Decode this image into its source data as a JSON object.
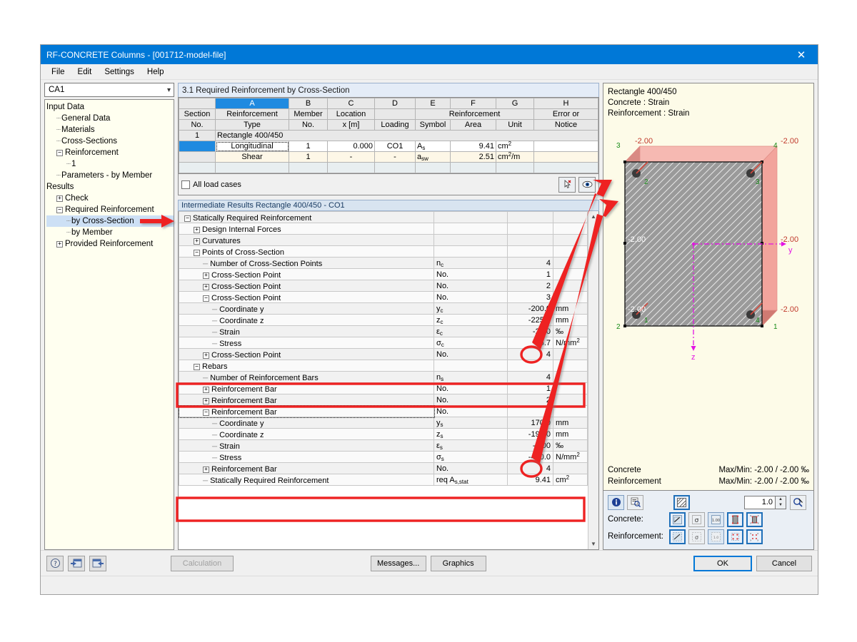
{
  "window": {
    "title": "RF-CONCRETE Columns - [001712-model-file]",
    "close_icon": "close-icon"
  },
  "menu": {
    "items": [
      "File",
      "Edit",
      "Settings",
      "Help"
    ]
  },
  "sidebar": {
    "combo_value": "CA1",
    "nodes": [
      {
        "label": "Input Data",
        "depth": 0,
        "toggle": "none",
        "selected": false
      },
      {
        "label": "General Data",
        "depth": 1,
        "toggle": "leaf",
        "selected": false
      },
      {
        "label": "Materials",
        "depth": 1,
        "toggle": "leaf",
        "selected": false
      },
      {
        "label": "Cross-Sections",
        "depth": 1,
        "toggle": "leaf",
        "selected": false
      },
      {
        "label": "Reinforcement",
        "depth": 1,
        "toggle": "minus",
        "selected": false
      },
      {
        "label": "1",
        "depth": 2,
        "toggle": "leaf",
        "selected": false
      },
      {
        "label": "Parameters - by Member",
        "depth": 1,
        "toggle": "leaf",
        "selected": false
      },
      {
        "label": "Results",
        "depth": 0,
        "toggle": "none",
        "selected": false
      },
      {
        "label": "Check",
        "depth": 1,
        "toggle": "plus",
        "selected": false
      },
      {
        "label": "Required Reinforcement",
        "depth": 1,
        "toggle": "minus",
        "selected": false
      },
      {
        "label": "by Cross-Section",
        "depth": 2,
        "toggle": "leaf",
        "selected": true
      },
      {
        "label": "by Member",
        "depth": 2,
        "toggle": "leaf",
        "selected": false
      },
      {
        "label": "Provided Reinforcement",
        "depth": 1,
        "toggle": "plus",
        "selected": false
      }
    ]
  },
  "main": {
    "panel_title": "3.1 Required Reinforcement by Cross-Section",
    "column_letters": [
      "A",
      "B",
      "C",
      "D",
      "E",
      "F",
      "G",
      "H"
    ],
    "group_headers": {
      "reinforcement": "Reinforcement"
    },
    "headers": [
      {
        "top": "Section",
        "bottom": "No."
      },
      {
        "top": "Reinforcement",
        "bottom": "Type"
      },
      {
        "top": "Member",
        "bottom": "No."
      },
      {
        "top": "Location",
        "bottom": "x [m]"
      },
      {
        "top": "",
        "bottom": "Loading"
      },
      {
        "top": "",
        "bottom": "Symbol"
      },
      {
        "top": "",
        "bottom": "Area"
      },
      {
        "top": "",
        "bottom": "Unit"
      },
      {
        "top": "Error or",
        "bottom": "Notice"
      }
    ],
    "section_row": {
      "no": "1",
      "label": "Rectangle 400/450"
    },
    "rows": [
      {
        "no": "",
        "type": "Longitudinal",
        "member": "1",
        "location": "0.000",
        "loading": "CO1",
        "symbol": "As",
        "symbol_base": "A",
        "symbol_sub": "s",
        "area": "9.41",
        "unit_base": "cm",
        "unit_sup": "2",
        "unit_suffix": "",
        "error": ""
      },
      {
        "no": "",
        "type": "Shear",
        "member": "1",
        "location": "-",
        "loading": "-",
        "symbol": "asw",
        "symbol_base": "a",
        "symbol_sub": "sw",
        "area": "2.51",
        "unit_base": "cm",
        "unit_sup": "2",
        "unit_suffix": "/m",
        "error": ""
      }
    ],
    "all_load_cases_label": "All load cases",
    "all_load_cases_checked": false,
    "pick_icon": "pick-cursor-icon",
    "view_icon": "eye-icon"
  },
  "intermediate": {
    "header": "Intermediate Results Rectangle 400/450 - CO1",
    "rows": [
      {
        "label": "Statically Required Reinforcement",
        "depth": 0,
        "toggle": "minus",
        "symbol": "",
        "value": "",
        "unit": "",
        "highlight": false
      },
      {
        "label": "Design Internal Forces",
        "depth": 1,
        "toggle": "plus",
        "symbol": "",
        "value": "",
        "unit": "",
        "highlight": false
      },
      {
        "label": "Curvatures",
        "depth": 1,
        "toggle": "plus",
        "symbol": "",
        "value": "",
        "unit": "",
        "highlight": false
      },
      {
        "label": "Points of Cross-Section",
        "depth": 1,
        "toggle": "minus",
        "symbol": "",
        "value": "",
        "unit": "",
        "highlight": false
      },
      {
        "label": "Number of Cross-Section Points",
        "depth": 2,
        "toggle": "leaf",
        "symbol": "nc",
        "symbol_base": "n",
        "symbol_sub": "c",
        "value": "4",
        "unit": "",
        "highlight": false
      },
      {
        "label": "Cross-Section Point",
        "depth": 2,
        "toggle": "plus",
        "symbol": "No.",
        "value": "1",
        "unit": "",
        "highlight": false
      },
      {
        "label": "Cross-Section Point",
        "depth": 2,
        "toggle": "plus",
        "symbol": "No.",
        "value": "2",
        "unit": "",
        "highlight": false
      },
      {
        "label": "Cross-Section Point",
        "depth": 2,
        "toggle": "minus",
        "symbol": "No.",
        "value": "3",
        "unit": "",
        "highlight": false,
        "circled": true
      },
      {
        "label": "Coordinate y",
        "depth": 3,
        "toggle": "leaf",
        "symbol": "yc",
        "symbol_base": "y",
        "symbol_sub": "c",
        "value": "-200.0",
        "unit": "mm",
        "highlight": false
      },
      {
        "label": "Coordinate z",
        "depth": 3,
        "toggle": "leaf",
        "symbol": "zc",
        "symbol_base": "z",
        "symbol_sub": "c",
        "value": "-225.0",
        "unit": "mm",
        "highlight": false
      },
      {
        "label": "Strain",
        "depth": 3,
        "toggle": "leaf",
        "symbol": "εc",
        "symbol_base": "ε",
        "symbol_sub": "c",
        "value": "-2.00",
        "unit": "‰",
        "highlight": true
      },
      {
        "label": "Stress",
        "depth": 3,
        "toggle": "leaf",
        "symbol": "σc",
        "symbol_base": "σ",
        "symbol_sub": "c",
        "value": "-16.7",
        "unit": "N/mm2",
        "unit_base": "N/mm",
        "unit_sup": "2",
        "highlight": true
      },
      {
        "label": "Cross-Section Point",
        "depth": 2,
        "toggle": "plus",
        "symbol": "No.",
        "value": "4",
        "unit": "",
        "highlight": false
      },
      {
        "label": "Rebars",
        "depth": 1,
        "toggle": "minus",
        "symbol": "",
        "value": "",
        "unit": "",
        "highlight": false
      },
      {
        "label": "Number of Reinforcement Bars",
        "depth": 2,
        "toggle": "leaf",
        "symbol": "ns",
        "symbol_base": "n",
        "symbol_sub": "s",
        "value": "4",
        "unit": "",
        "highlight": false
      },
      {
        "label": "Reinforcement Bar",
        "depth": 2,
        "toggle": "plus",
        "symbol": "No.",
        "value": "1",
        "unit": "",
        "highlight": false
      },
      {
        "label": "Reinforcement Bar",
        "depth": 2,
        "toggle": "plus",
        "symbol": "No.",
        "value": "2",
        "unit": "",
        "highlight": false
      },
      {
        "label": "Reinforcement Bar",
        "depth": 2,
        "toggle": "minus",
        "symbol": "No.",
        "value": "3",
        "unit": "",
        "highlight": false,
        "circled": true,
        "focused": true
      },
      {
        "label": "Coordinate y",
        "depth": 3,
        "toggle": "leaf",
        "symbol": "ys",
        "symbol_base": "y",
        "symbol_sub": "s",
        "value": "170.0",
        "unit": "mm",
        "highlight": false
      },
      {
        "label": "Coordinate z",
        "depth": 3,
        "toggle": "leaf",
        "symbol": "zs",
        "symbol_base": "z",
        "symbol_sub": "s",
        "value": "-195.0",
        "unit": "mm",
        "highlight": false
      },
      {
        "label": "Strain",
        "depth": 3,
        "toggle": "leaf",
        "symbol": "εs",
        "symbol_base": "ε",
        "symbol_sub": "s",
        "value": "-2.00",
        "unit": "‰",
        "highlight": true
      },
      {
        "label": "Stress",
        "depth": 3,
        "toggle": "leaf",
        "symbol": "σs",
        "symbol_base": "σ",
        "symbol_sub": "s",
        "value": "-400.0",
        "unit": "N/mm2",
        "unit_base": "N/mm",
        "unit_sup": "2",
        "highlight": true
      },
      {
        "label": "Reinforcement Bar",
        "depth": 2,
        "toggle": "plus",
        "symbol": "No.",
        "value": "4",
        "unit": "",
        "highlight": false
      },
      {
        "label": "Statically Required Reinforcement",
        "depth": 2,
        "toggle": "leaf",
        "symbol": "req As,stat",
        "symbol_base": "req A",
        "symbol_sub": "s,stat",
        "value": "9.41",
        "unit": "cm2",
        "unit_base": "cm",
        "unit_sup": "2",
        "highlight": false
      }
    ]
  },
  "graphic": {
    "title_lines": [
      "Rectangle 400/450",
      "Concrete : Strain",
      "Reinforcement : Strain"
    ],
    "strain_labels": {
      "top_left": "-2.00",
      "top_right": "-2.00",
      "mid_left": "-2.00",
      "mid_right": "-2.00",
      "bottom_left": "-2.00",
      "bottom_right": "-2.00"
    },
    "corner_point_numbers": {
      "tl": "3",
      "tr": "4",
      "bl": "2",
      "br": "1"
    },
    "rebar_numbers": {
      "tl": "2",
      "tr": "3",
      "bl": "1",
      "br": "4"
    },
    "axis_labels": {
      "y": "y",
      "z": "z"
    },
    "footer": [
      {
        "name": "Concrete",
        "value": "Max/Min: -2.00 / -2.00 ‰"
      },
      {
        "name": "Reinforcement",
        "value": "Max/Min: -2.00 / -2.00 ‰"
      }
    ]
  },
  "graphic_toolbar": {
    "info_icon": "info-icon",
    "zoom_detail_icon": "zoom-detail-icon",
    "hatch_icon": "hatch-pattern-icon",
    "scale_value": "1.0",
    "scale_reset_icon": "reset-scale-icon",
    "rows": [
      {
        "label": "Concrete:",
        "buttons": [
          {
            "icon": "concrete-strain-icon",
            "state": "on"
          },
          {
            "icon": "concrete-stress-icon",
            "state": "off"
          },
          {
            "icon": "concrete-values-icon",
            "state": "mid"
          },
          {
            "icon": "concrete-diagram-icon",
            "state": "on"
          },
          {
            "icon": "concrete-labels-icon",
            "state": "on"
          }
        ]
      },
      {
        "label": "Reinforcement:",
        "buttons": [
          {
            "icon": "rebar-strain-icon",
            "state": "on"
          },
          {
            "icon": "rebar-stress-icon",
            "state": "off"
          },
          {
            "icon": "rebar-values-icon",
            "state": "mid"
          },
          {
            "icon": "rebar-diagram-icon",
            "state": "on"
          },
          {
            "icon": "rebar-labels-icon",
            "state": "on"
          }
        ]
      }
    ]
  },
  "footer": {
    "help_icon": "help-icon",
    "prev_icon": "previous-icon",
    "next_icon": "next-icon",
    "calculation_label": "Calculation",
    "messages_label": "Messages...",
    "graphics_label": "Graphics",
    "ok_label": "OK",
    "cancel_label": "Cancel"
  },
  "colors": {
    "accent": "#0078d7",
    "annotation_red": "#ee2222",
    "graphic_bg": "#fdfbe8",
    "selection_blue": "#1f8ae0"
  }
}
